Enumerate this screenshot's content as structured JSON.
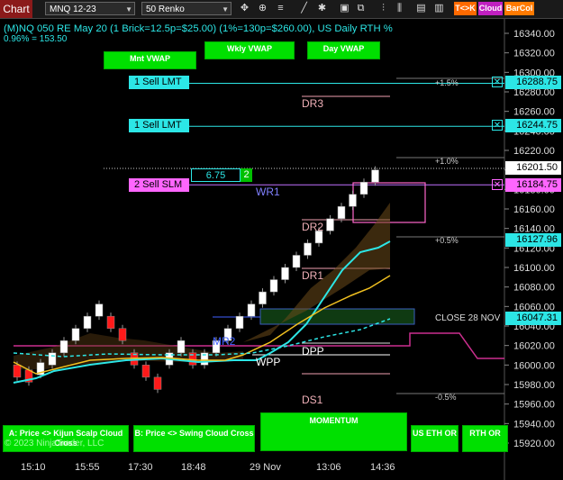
{
  "toolbar": {
    "title": "Chart",
    "instrument": "MNQ 12-23",
    "period": "50 Renko",
    "badges": {
      "tk": "T<>K",
      "cloud": "Cloud",
      "barcol": "BarCol"
    }
  },
  "chart": {
    "header_line": "(M)NQ 050 RE May 20 (1 Brick=12.5p=$25.00) (1%=130p=$260.00), US Daily RTH %",
    "header_sub": "0.96% = 153.50",
    "copyright": "© 2023 NinjaTrader, LLC",
    "buttons": {
      "mnt_vwap": "Mnt VWAP",
      "wkly_vwap": "Wkly VWAP",
      "day_vwap": "Day VWAP",
      "kijun": "A: Price <> Kijun Scalp Cloud Cross",
      "swing": "B: Price <> Swing Cloud Cross",
      "momentum": "MOMENTUM",
      "us_eth_or": "US ETH OR",
      "rth_or": "RTH OR"
    },
    "orders": [
      {
        "label": "1 Sell LMT",
        "price": "16288.75"
      },
      {
        "label": "1 Sell LMT",
        "price": "16244.75"
      },
      {
        "label": "2 Sell SLM",
        "price": "16184.75"
      }
    ],
    "position": {
      "pnl": "6.75",
      "qty": "2"
    },
    "current_price": "16201.50",
    "other_tags": {
      "level1": "16127.96",
      "level2": "16047.31"
    },
    "levels": {
      "dr3": "DR3",
      "dr2": "DR2",
      "dr1": "DR1",
      "wr1": "WR1",
      "mr2": "MR2",
      "dpp": "DPP",
      "wpp": "WPP",
      "ds1": "DS1",
      "p15": "+1.5%",
      "p10": "+1.0%",
      "p05": "+0.5%",
      "m05": "-0.5%",
      "close": "CLOSE 28 NOV"
    },
    "y_axis": [
      "16340.00",
      "16320.00",
      "16300.00",
      "16280.00",
      "16260.00",
      "16240.00",
      "16220.00",
      "16200.00",
      "16180.00",
      "16160.00",
      "16140.00",
      "16120.00",
      "16100.00",
      "16080.00",
      "16060.00",
      "16040.00",
      "16020.00",
      "16000.00",
      "15980.00",
      "15960.00",
      "15940.00",
      "15920.00"
    ],
    "x_axis": [
      "15:10",
      "15:55",
      "17:30",
      "18:48",
      "29 Nov",
      "13:06",
      "14:36"
    ],
    "colors": {
      "bull": "#ffffff",
      "bear": "#ff1a1a",
      "cyan": "#2ce6e6",
      "gold": "#f0c020",
      "magenta": "#cc2f8f",
      "green": "#00e000"
    }
  },
  "chart_data": {
    "type": "candlestick",
    "bricks": [
      {
        "dir": "bear",
        "o": 16000,
        "c": 15987.5
      },
      {
        "dir": "bear",
        "o": 15995,
        "c": 15982.5
      },
      {
        "dir": "bull",
        "o": 15990,
        "c": 16002.5
      },
      {
        "dir": "bull",
        "o": 16000,
        "c": 16012.5
      },
      {
        "dir": "bull",
        "o": 16012.5,
        "c": 16025
      },
      {
        "dir": "bull",
        "o": 16025,
        "c": 16037.5
      },
      {
        "dir": "bull",
        "o": 16037.5,
        "c": 16050
      },
      {
        "dir": "bull",
        "o": 16050,
        "c": 16062.5
      },
      {
        "dir": "bear",
        "o": 16050,
        "c": 16037.5
      },
      {
        "dir": "bear",
        "o": 16037.5,
        "c": 16025
      },
      {
        "dir": "bear",
        "o": 16012.5,
        "c": 16000
      },
      {
        "dir": "bear",
        "o": 16000,
        "c": 15987.5
      },
      {
        "dir": "bear",
        "o": 15987.5,
        "c": 15975
      },
      {
        "dir": "bull",
        "o": 16000,
        "c": 16012.5
      },
      {
        "dir": "bull",
        "o": 16012.5,
        "c": 16025
      },
      {
        "dir": "bear",
        "o": 16012.5,
        "c": 16000
      },
      {
        "dir": "bull",
        "o": 16000,
        "c": 16012.5
      },
      {
        "dir": "bull",
        "o": 16012.5,
        "c": 16025
      },
      {
        "dir": "bull",
        "o": 16025,
        "c": 16037.5
      },
      {
        "dir": "bull",
        "o": 16037.5,
        "c": 16050
      },
      {
        "dir": "bull",
        "o": 16050,
        "c": 16062.5
      },
      {
        "dir": "bull",
        "o": 16062.5,
        "c": 16075
      },
      {
        "dir": "bull",
        "o": 16075,
        "c": 16087.5
      },
      {
        "dir": "bull",
        "o": 16087.5,
        "c": 16100
      },
      {
        "dir": "bull",
        "o": 16100,
        "c": 16112.5
      },
      {
        "dir": "bull",
        "o": 16112.5,
        "c": 16125
      },
      {
        "dir": "bull",
        "o": 16125,
        "c": 16137.5
      },
      {
        "dir": "bull",
        "o": 16137.5,
        "c": 16150
      },
      {
        "dir": "bull",
        "o": 16150,
        "c": 16162.5
      },
      {
        "dir": "bull",
        "o": 16162.5,
        "c": 16175
      },
      {
        "dir": "bull",
        "o": 16175,
        "c": 16187.5
      },
      {
        "dir": "bull",
        "o": 16187.5,
        "c": 16200
      }
    ]
  }
}
